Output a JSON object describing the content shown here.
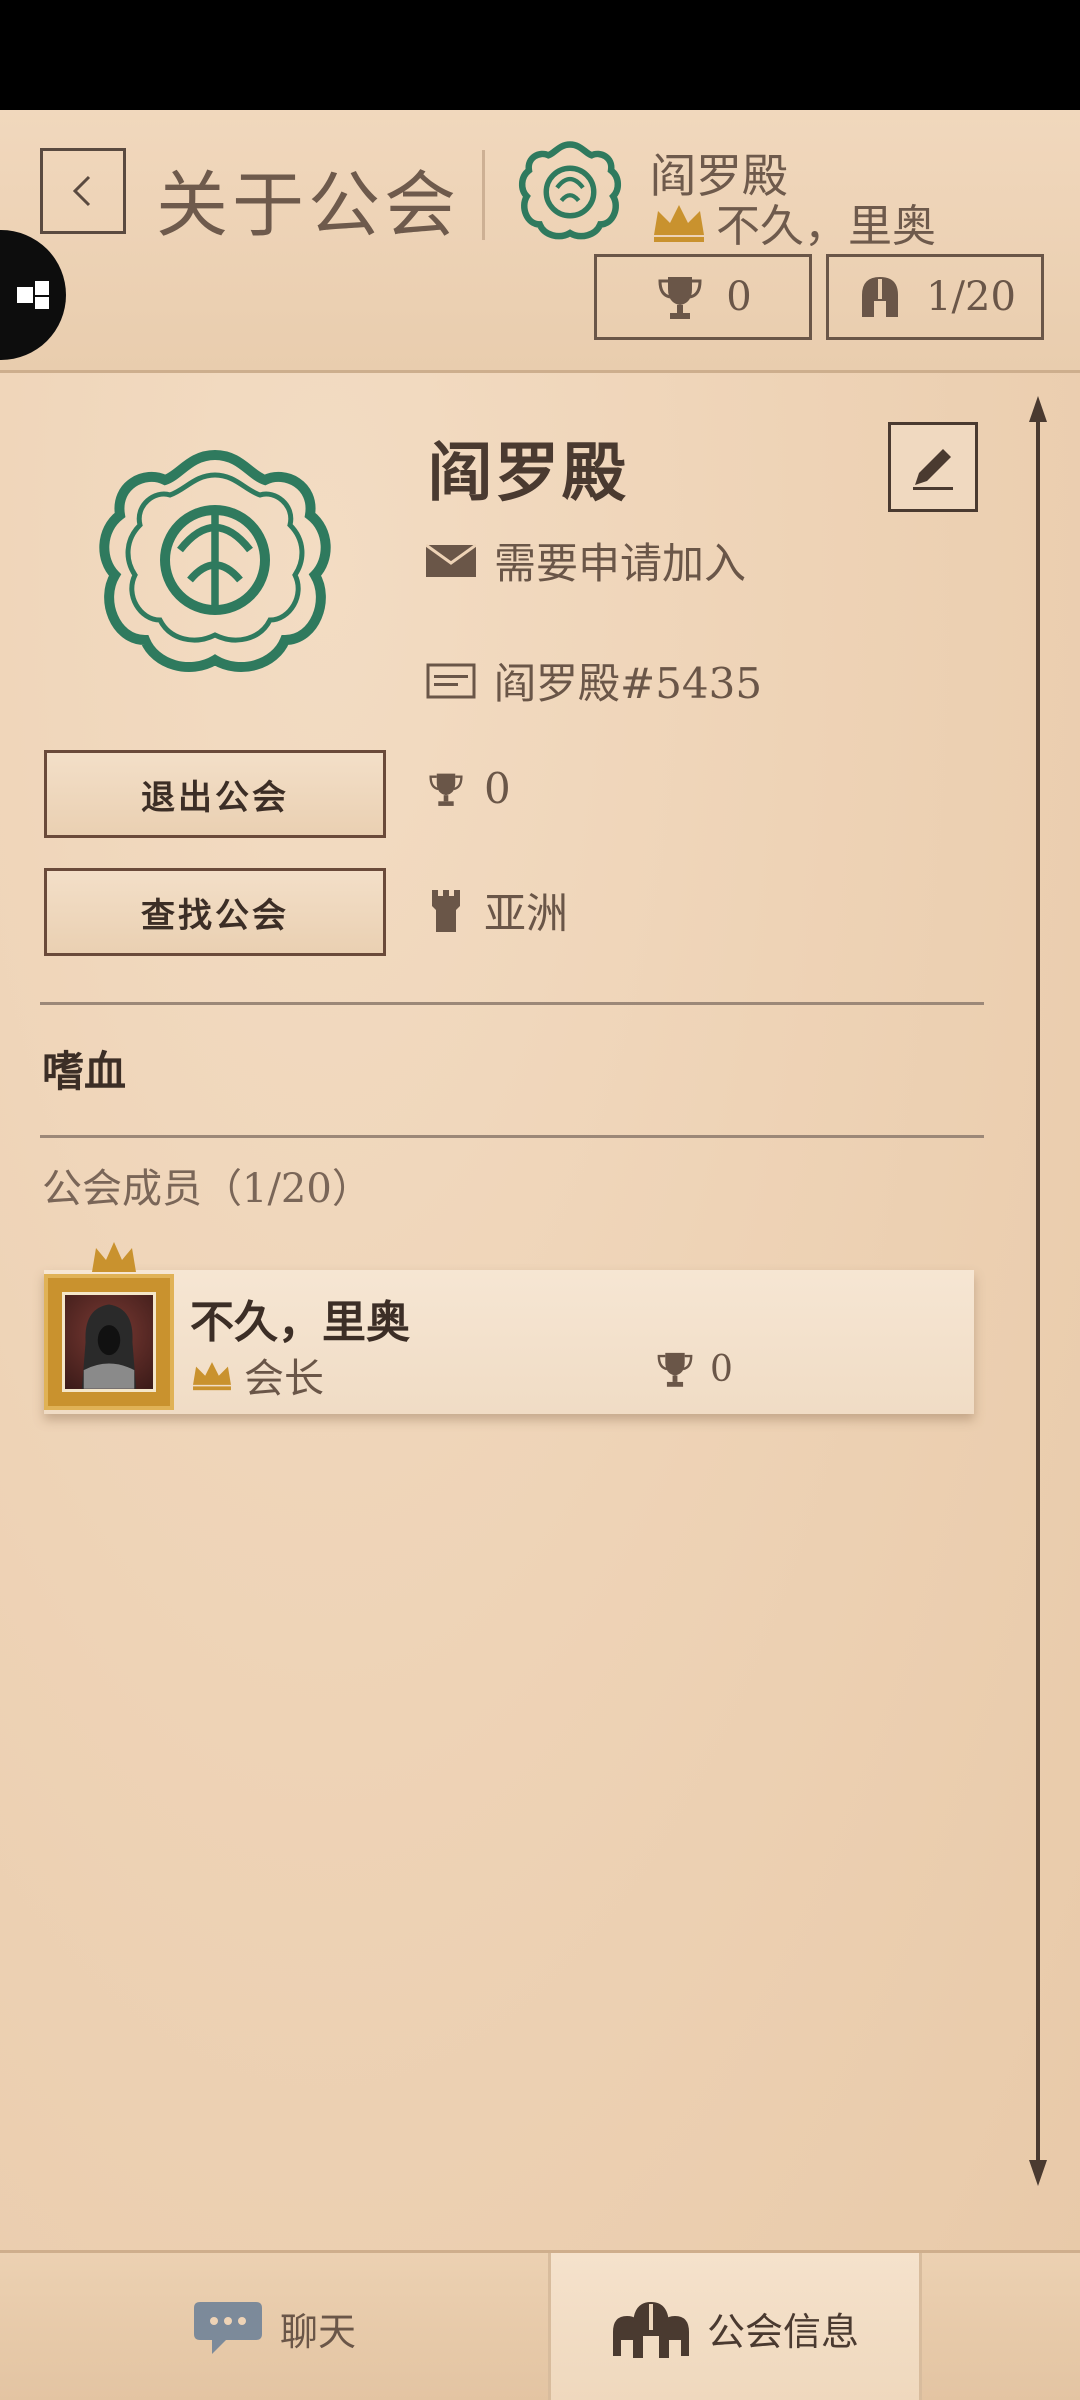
{
  "header": {
    "title": "关于公会",
    "guild_name": "阎罗殿",
    "leader_name": "不久，里奥",
    "trophies": "0",
    "member_count": "1/20"
  },
  "guild": {
    "name": "阎罗殿",
    "join_type": "需要申请加入",
    "tag": "阎罗殿#5435",
    "trophies": "0",
    "region": "亚洲",
    "description": "嗜血"
  },
  "buttons": {
    "leave": "退出公会",
    "find": "查找公会"
  },
  "members": {
    "title": "公会成员（1/20）",
    "list": [
      {
        "name": "不久，里奥",
        "role": "会长",
        "trophies": "0"
      }
    ]
  },
  "tabs": {
    "chat": "聊天",
    "guild_info": "公会信息"
  },
  "colors": {
    "emblem_green": "#2f7a5e",
    "crown_gold": "#c9922e",
    "parchment": "#eed3b6"
  }
}
